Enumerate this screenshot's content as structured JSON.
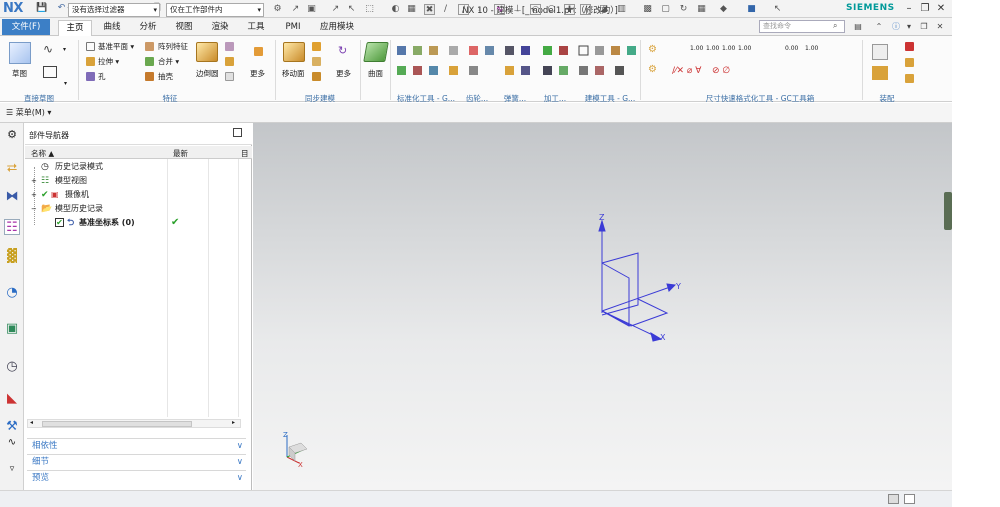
{
  "app": {
    "logo": "NX",
    "title": "NX 10 - 建模 - [_model1.prt（修改的）]",
    "brand": "SIEMENS",
    "window_menu": "窗口"
  },
  "menu": {
    "file": "文件(F)",
    "tabs": [
      "主页",
      "曲线",
      "分析",
      "视图",
      "渲染",
      "工具",
      "PMI",
      "应用模块"
    ],
    "search_placeholder": "查找命令"
  },
  "ribbon": {
    "sketch": "草图",
    "datum_plane": "基准平面",
    "pattern_feature": "阵列特征",
    "extrude": "拉伸",
    "unite": "合并",
    "hole": "孔",
    "shell": "抽壳",
    "edge_blend": "边倒圆",
    "more1": "更多",
    "move_face": "移动面",
    "more2": "更多",
    "surface": "曲面",
    "more3": "更多",
    "groups": [
      "直接草图",
      "特征",
      "同步建模",
      "标准化工具 - G...",
      "齿轮...",
      "弹簧...",
      "加工...",
      "建模工具 - G...",
      "尺寸快速格式化工具 - GC工具箱",
      "装配"
    ],
    "dim_labels": [
      "1.00",
      "1.00",
      "1.00",
      "1.00",
      "0.00",
      "1.00"
    ]
  },
  "toolbar2": {
    "menu": "菜单(M)",
    "filter": "没有选择过滤器",
    "scope": "仅在工作部件内"
  },
  "navigator": {
    "title": "部件导航器",
    "col_name": "名称",
    "col_latest": "最新",
    "col_extra": "目",
    "items": [
      {
        "label": "历史记录模式"
      },
      {
        "label": "模型视图"
      },
      {
        "label": "摄像机"
      },
      {
        "label": "模型历史记录"
      },
      {
        "label": "基准坐标系 (0)"
      }
    ],
    "panels": [
      "相依性",
      "细节",
      "预览"
    ]
  },
  "viewport": {
    "axis_x": "X",
    "axis_y": "Y",
    "axis_z": "Z"
  },
  "colors": {
    "accent": "#3c7fc6",
    "datum": "#3b3bd6",
    "check": "#2aa02a"
  }
}
